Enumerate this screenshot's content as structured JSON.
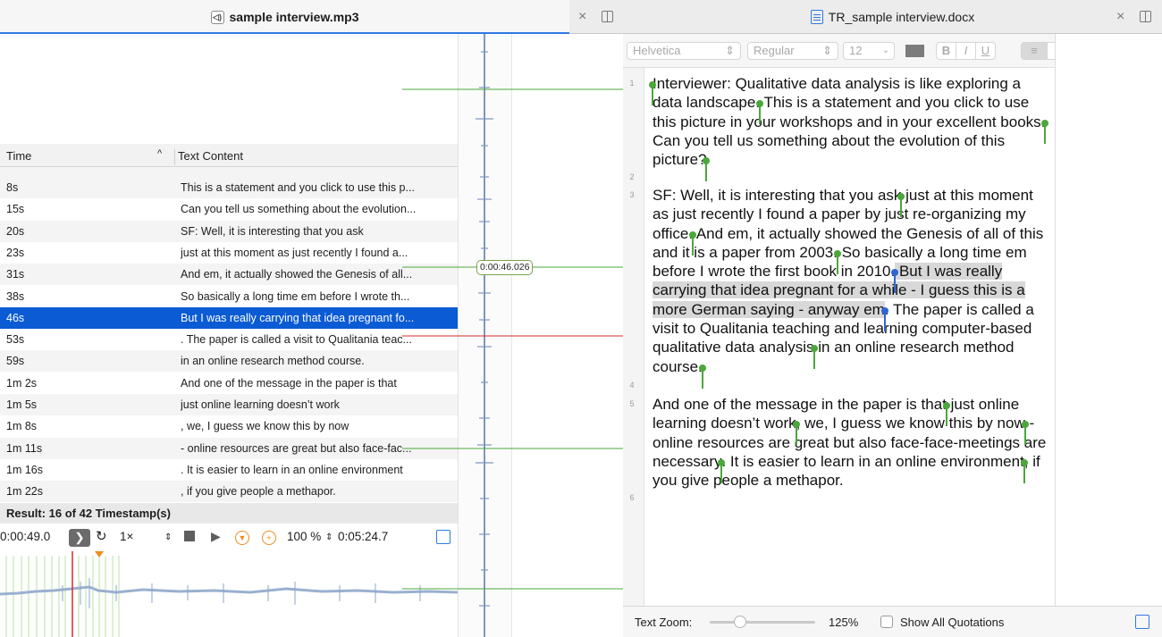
{
  "left_tab": {
    "title": "sample interview.mp3"
  },
  "right_tab": {
    "title": "TR_sample interview.docx",
    "close": "×"
  },
  "mid_tab": {
    "close": "×"
  },
  "table": {
    "col_time": "Time",
    "col_text": "Text Content",
    "sort_indicator": "^",
    "rows": [
      {
        "time": "8s",
        "text": "This is a statement and you click to use this p...",
        "selected": false
      },
      {
        "time": "15s",
        "text": "Can you tell us something about the evolution...",
        "selected": false
      },
      {
        "time": "20s",
        "text": "SF: Well, it is interesting that you ask",
        "selected": false
      },
      {
        "time": "23s",
        "text": "just at this moment as just recently I found a...",
        "selected": false
      },
      {
        "time": "31s",
        "text": "And em, it actually showed the Genesis of all...",
        "selected": false
      },
      {
        "time": "38s",
        "text": "So basically a long time em  before I wrote th...",
        "selected": false
      },
      {
        "time": "46s",
        "text": "But I was really carrying that idea pregnant fo...",
        "selected": true
      },
      {
        "time": "53s",
        "text": ". The paper is called a visit to Qualitania teac...",
        "selected": false
      },
      {
        "time": "59s",
        "text": "in an online research method course.",
        "selected": false
      },
      {
        "time": "1m 2s",
        "text": "And one of the message in the paper is that",
        "selected": false
      },
      {
        "time": "1m 5s",
        "text": "just online learning doesn’t work",
        "selected": false
      },
      {
        "time": "1m 8s",
        "text": ", we, I guess we know this by now",
        "selected": false
      },
      {
        "time": "1m 11s",
        "text": "- online resources are great but also face-fac...",
        "selected": false
      },
      {
        "time": "1m 16s",
        "text": ". It is easier to learn in an online environment",
        "selected": false
      },
      {
        "time": "1m 22s",
        "text": ", if you give people a methapor.",
        "selected": false
      }
    ],
    "result": "Result: 16 of 42 Timestamp(s)"
  },
  "transport": {
    "current_time": "0:00:49.0",
    "speed": "1×",
    "volume": "100 %",
    "duration": "0:05:24.7"
  },
  "waveform": {
    "timestamp_bubble": "0:00:46.026"
  },
  "format_bar": {
    "font": "Helvetica",
    "style": "Regular",
    "size": "12",
    "bold": "B",
    "italic": "I",
    "underline": "U"
  },
  "document": {
    "line_numbers": [
      "1",
      "2",
      "3",
      "4",
      "5",
      "6"
    ],
    "p1": {
      "a": "Interviewer: Qualitative data analysis is like exploring a data landscape.",
      "b": " This is a statement and you click to use this picture in your workshops and in your excellent books.",
      "c": " Can you tell us something about the evolution of this picture?"
    },
    "p3": {
      "a": "SF: Well, it is interesting that you ask",
      "b": " just at this moment as just recently I found a paper by just re-organizing my office.",
      "c": " And em, it actually showed the Genesis of all of this and it is a paper from 2003.",
      "d": " So basically a long time em  before I wrote the first book in 2010.",
      "e": " But I was really carrying that idea pregnant for a while - I guess this is a more German saying - anyway em",
      "f": ". The paper is called a visit to Qualitania teaching and learning computer-based qualitative data analysis",
      "g": " in an online research method course."
    },
    "p5": {
      "a": "And one of the message in the paper is that",
      "b": " just online learning doesn’t work",
      "c": ", we, I guess we know this by now",
      "d": " - online resources are great but also face-face-meetings are necessary",
      "e": ". It is easier to learn in an online environment",
      "f": ", if you give people a methapor."
    }
  },
  "status_bar": {
    "text_zoom_label": "Text Zoom:",
    "zoom_value": "125%",
    "show_all_label": "Show All Quotations"
  },
  "colors": {
    "selection": "#0a5bd4",
    "pin_green": "#4aa83a",
    "pin_blue": "#2e66d0",
    "playhead": "#d42b2b",
    "accent": "#2f7ae5"
  }
}
